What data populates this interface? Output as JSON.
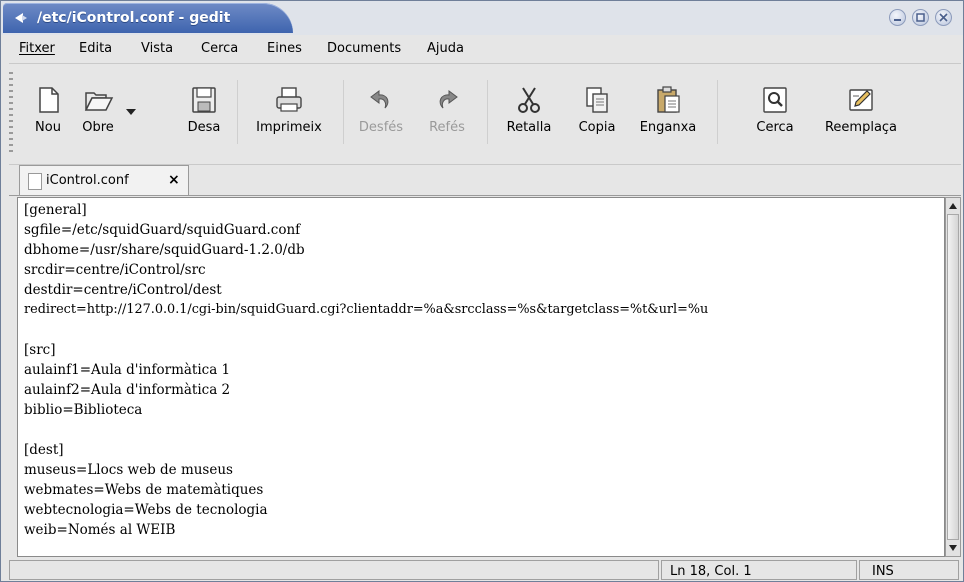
{
  "window": {
    "title": "/etc/iControl.conf - gedit",
    "controls": {
      "minimize_icon": "minimize-icon",
      "maximize_icon": "maximize-icon",
      "close_icon": "close-icon"
    }
  },
  "menubar": {
    "items": [
      {
        "label": "Fitxer",
        "mnemonic": "F"
      },
      {
        "label": "Edita",
        "mnemonic": "E"
      },
      {
        "label": "Vista",
        "mnemonic": "V"
      },
      {
        "label": "Cerca",
        "mnemonic": "C"
      },
      {
        "label": "Eines",
        "mnemonic": "E"
      },
      {
        "label": "Documents",
        "mnemonic": "D"
      },
      {
        "label": "Ajuda",
        "mnemonic": "j"
      }
    ]
  },
  "toolbar": {
    "new_label": "Nou",
    "open_label": "Obre",
    "save_label": "Desa",
    "print_label": "Imprimeix",
    "undo_label": "Desfés",
    "redo_label": "Refés",
    "cut_label": "Retalla",
    "copy_label": "Copia",
    "paste_label": "Enganxa",
    "find_label": "Cerca",
    "replace_label": "Reemplaça"
  },
  "tabs": [
    {
      "label": "iControl.conf",
      "close": "×"
    }
  ],
  "editor": {
    "lines": [
      "[general]",
      "sgfile=/etc/squidGuard/squidGuard.conf",
      "dbhome=/usr/share/squidGuard-1.2.0/db",
      "srcdir=centre/iControl/src",
      "destdir=centre/iControl/dest",
      "redirect=http://127.0.0.1/cgi-bin/squidGuard.cgi?clientaddr=%a&srcclass=%s&targetclass=%t&url=%u",
      "",
      "[src]",
      "aulainf1=Aula d'informàtica 1",
      "aulainf2=Aula d'informàtica 2",
      "biblio=Biblioteca",
      "",
      "[dest]",
      "museus=Llocs web de museus",
      "webmates=Webs de matemàtiques",
      "webtecnologia=Webs de tecnologia",
      "weib=Només al WEIB"
    ]
  },
  "statusbar": {
    "position": "Ln 18, Col. 1",
    "mode": "INS"
  }
}
